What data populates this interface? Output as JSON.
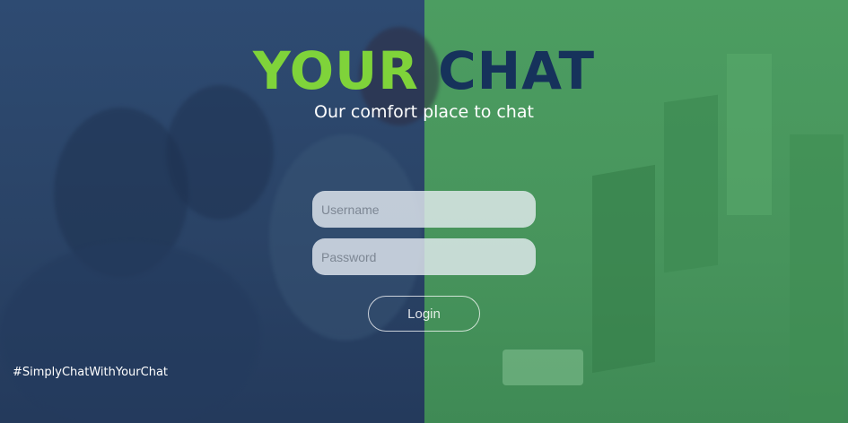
{
  "header": {
    "title_part1": "YOUR",
    "title_part2": "CHAT",
    "subtitle": "Our comfort place to chat"
  },
  "form": {
    "username_placeholder": "Username",
    "password_placeholder": "Password",
    "login_label": "Login"
  },
  "footer": {
    "hashtag": "#SimplyChatWithYourChat"
  },
  "colors": {
    "left_overlay": "#2e4b72",
    "right_overlay": "#4c9d61",
    "title_accent": "#7fd33a",
    "title_dark": "#16325b"
  }
}
